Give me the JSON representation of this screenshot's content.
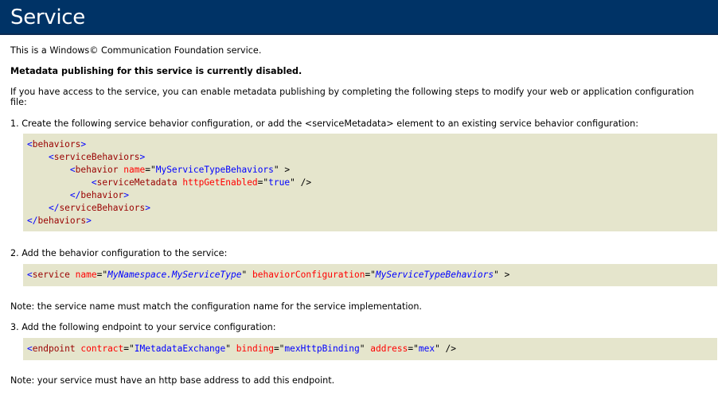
{
  "header": {
    "title": "Service"
  },
  "intro": "This is a Windows© Communication Foundation service.",
  "disabled_notice": "Metadata publishing for this service is currently disabled.",
  "instructions": "If you have access to the service, you can enable metadata publishing by completing the following steps to modify your web or application configuration file:",
  "steps": [
    {
      "text": "1. Create the following service behavior configuration, or add the <serviceMetadata> element to an existing service behavior configuration:"
    },
    {
      "text": "2. Add the behavior configuration to the service:"
    },
    {
      "text": "3. Add the following endpoint to your service configuration:"
    }
  ],
  "code1": {
    "l1_open": "<",
    "l1_tag": "behaviors",
    "l1_close": ">",
    "l2_indent": "    ",
    "l2_open": "<",
    "l2_tag": "serviceBehaviors",
    "l2_close": ">",
    "l3_indent": "        ",
    "l3_open": "<",
    "l3_tag": "behavior",
    "l3_attr": "name",
    "l3_eq": "=\"",
    "l3_val": "MyServiceTypeBehaviors",
    "l3_end": "\" >",
    "l4_indent": "            ",
    "l4_open": "<",
    "l4_tag": "serviceMetadata",
    "l4_attr": "httpGetEnabled",
    "l4_eq": "=\"",
    "l4_val": "true",
    "l4_end": "\" />",
    "l5_indent": "        ",
    "l5_open": "</",
    "l5_tag": "behavior",
    "l5_close": ">",
    "l6_indent": "    ",
    "l6_open": "</",
    "l6_tag": "serviceBehaviors",
    "l6_close": ">",
    "l7_open": "</",
    "l7_tag": "behaviors",
    "l7_close": ">"
  },
  "code2": {
    "open": "<",
    "tag": "service",
    "attr1": "name",
    "eq1": "=\"",
    "val1": "MyNamespace.MyServiceType",
    "q1": "\"",
    "attr2": "behaviorConfiguration",
    "eq2": "=\"",
    "val2": "MyServiceTypeBehaviors",
    "end": "\" >"
  },
  "note1": "Note: the service name must match the configuration name for the service implementation.",
  "code3": {
    "open": "<",
    "tag": "endpoint",
    "attr1": "contract",
    "eq1": "=\"",
    "val1": "IMetadataExchange",
    "q1": "\"",
    "attr2": "binding",
    "eq2": "=\"",
    "val2": "mexHttpBinding",
    "q2": "\"",
    "attr3": "address",
    "eq3": "=\"",
    "val3": "mex",
    "end": "\" />"
  },
  "note2": "Note: your service must have an http base address to add this endpoint."
}
